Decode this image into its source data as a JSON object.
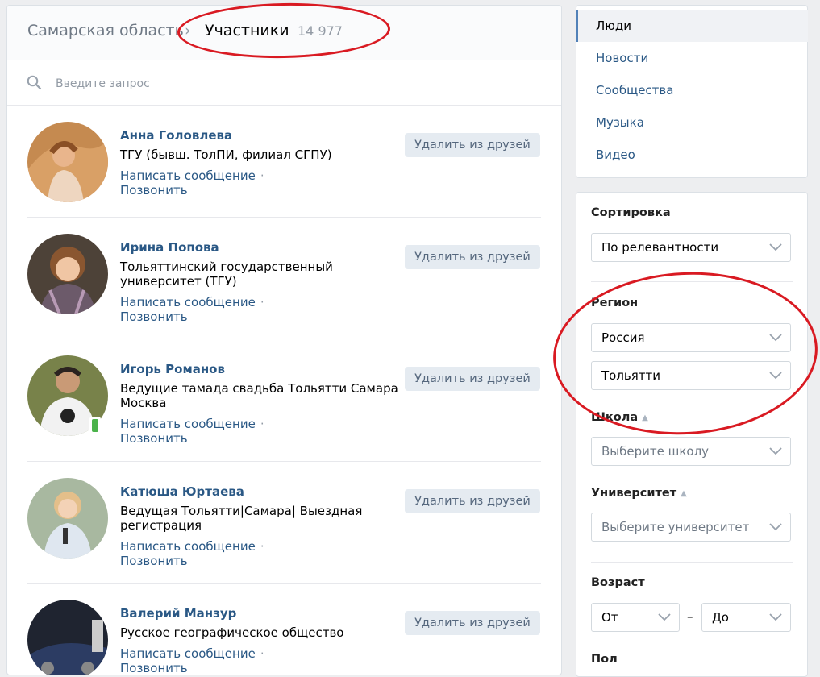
{
  "header": {
    "breadcrumb": "Самарская область",
    "title": "Участники",
    "count": "14 977"
  },
  "search": {
    "placeholder": "Введите запрос"
  },
  "people": [
    {
      "name": "Анна Головлева",
      "info": "ТГУ (бывш. ТолПИ, филиал СГПУ)",
      "message": "Написать сообщение",
      "call": "Позвонить",
      "button": "Удалить из друзей"
    },
    {
      "name": "Ирина Попова",
      "info": "Тольяттинский государственный университет (ТГУ)",
      "message": "Написать сообщение",
      "call": "Позвонить",
      "button": "Удалить из друзей"
    },
    {
      "name": "Игорь Романов",
      "info": "Ведущие тамада свадьба Тольятти Самара Москва",
      "message": "Написать сообщение",
      "call": "Позвонить",
      "button": "Удалить из друзей"
    },
    {
      "name": "Катюша Юртаева",
      "info": "Ведущая Тольятти|Самара| Выездная регистрация",
      "message": "Написать сообщение",
      "call": "Позвонить",
      "button": "Удалить из друзей"
    },
    {
      "name": "Валерий Манзур",
      "info": "Русское географическое общество",
      "message": "Написать сообщение",
      "call": "Позвонить",
      "button": "Удалить из друзей"
    }
  ],
  "menu": {
    "items": [
      "Люди",
      "Новости",
      "Сообщества",
      "Музыка",
      "Видео"
    ]
  },
  "filters": {
    "sort_label": "Сортировка",
    "sort_value": "По релевантности",
    "region_label": "Регион",
    "country": "Россия",
    "city": "Тольятти",
    "school_label": "Школа",
    "school_placeholder": "Выберите школу",
    "university_label": "Университет",
    "university_placeholder": "Выберите университет",
    "age_label": "Возраст",
    "age_from": "От",
    "age_dash": "–",
    "age_to": "До",
    "gender_label": "Пол"
  },
  "colors": {
    "link": "#2a5885",
    "annotation": "#d91a22",
    "online": "#4bb34b"
  }
}
